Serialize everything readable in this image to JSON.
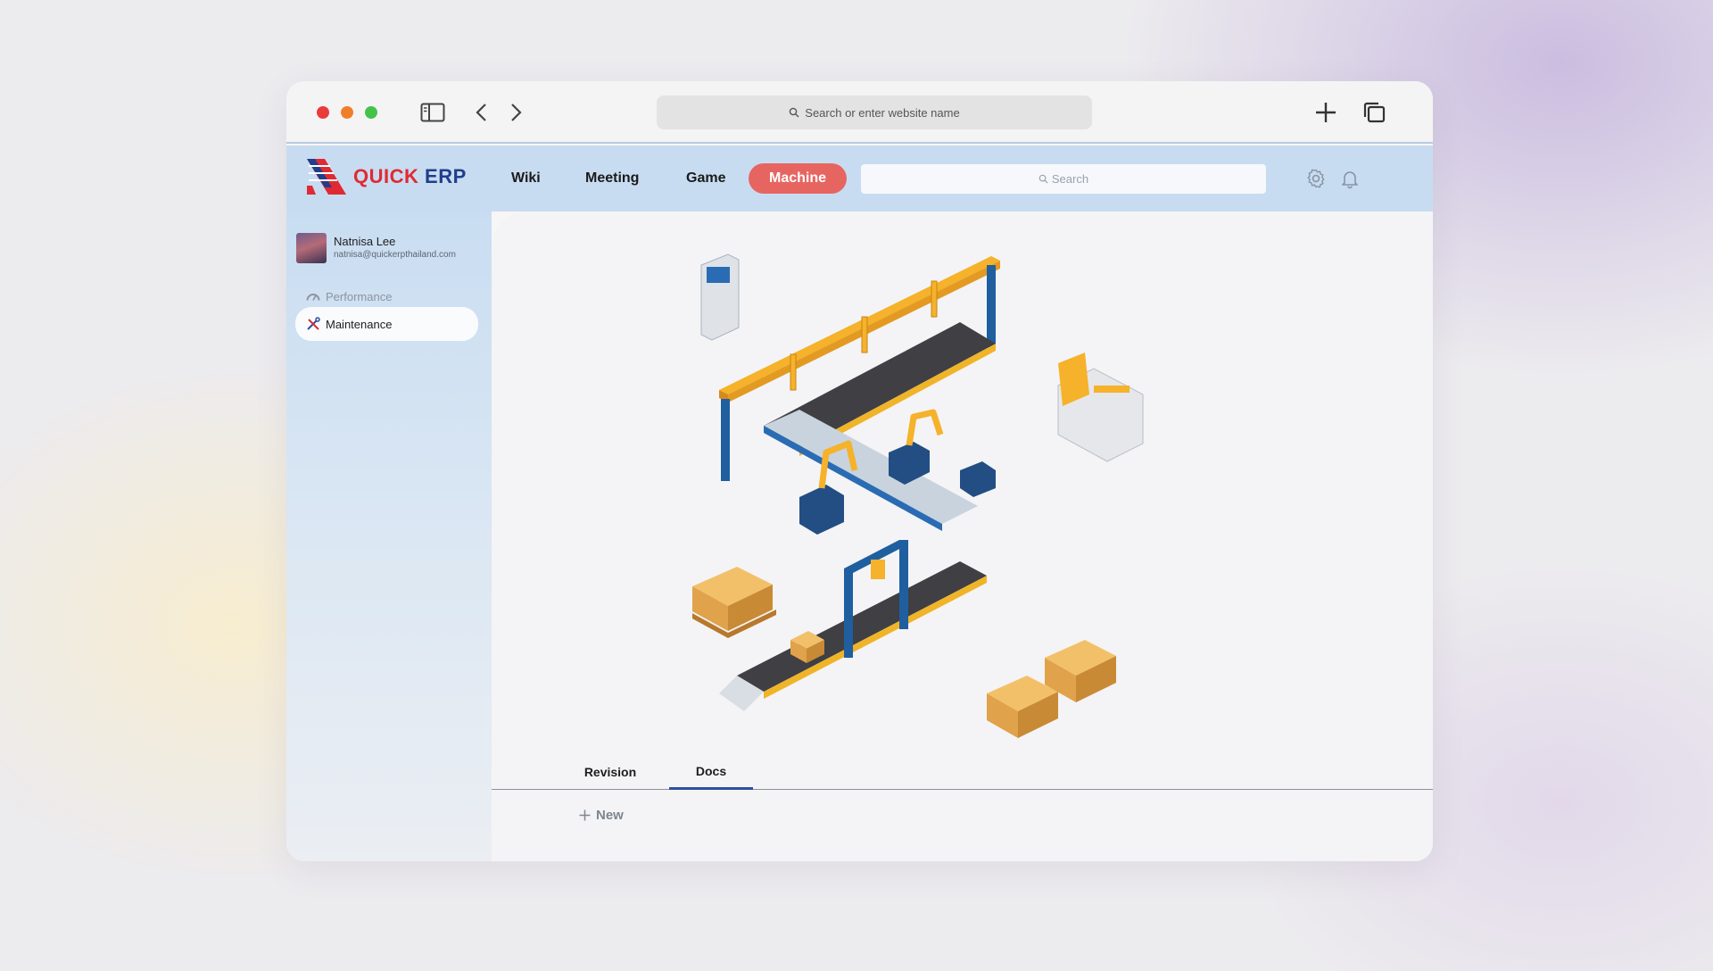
{
  "browser": {
    "address_placeholder": "Search or enter website name",
    "icons": [
      "sidebar-toggle-icon",
      "back-icon",
      "forward-icon",
      "new-tab-icon",
      "tabs-overview-icon"
    ]
  },
  "app": {
    "logo": {
      "quick": "QUICK",
      "erp": "ERP"
    },
    "nav": [
      {
        "label": "Wiki"
      },
      {
        "label": "Meeting"
      },
      {
        "label": "Game"
      },
      {
        "label": "Machine",
        "active": true
      }
    ],
    "search_placeholder": "Search",
    "icons": [
      "gear-icon",
      "bell-icon"
    ]
  },
  "sidebar": {
    "user": {
      "name": "Natnisa Lee",
      "email": "natnisa@quickerpthailand.com"
    },
    "items": [
      {
        "label": "Performance",
        "icon": "gauge-icon"
      },
      {
        "label": "Maintenance",
        "icon": "tools-icon",
        "active": true
      }
    ]
  },
  "main": {
    "tabs": [
      {
        "label": "Revision"
      },
      {
        "label": "Docs",
        "active": true
      }
    ],
    "new_label": "New"
  },
  "colors": {
    "accent": "#e76561",
    "brand_red": "#e02a33",
    "brand_blue": "#1f3e8c"
  }
}
